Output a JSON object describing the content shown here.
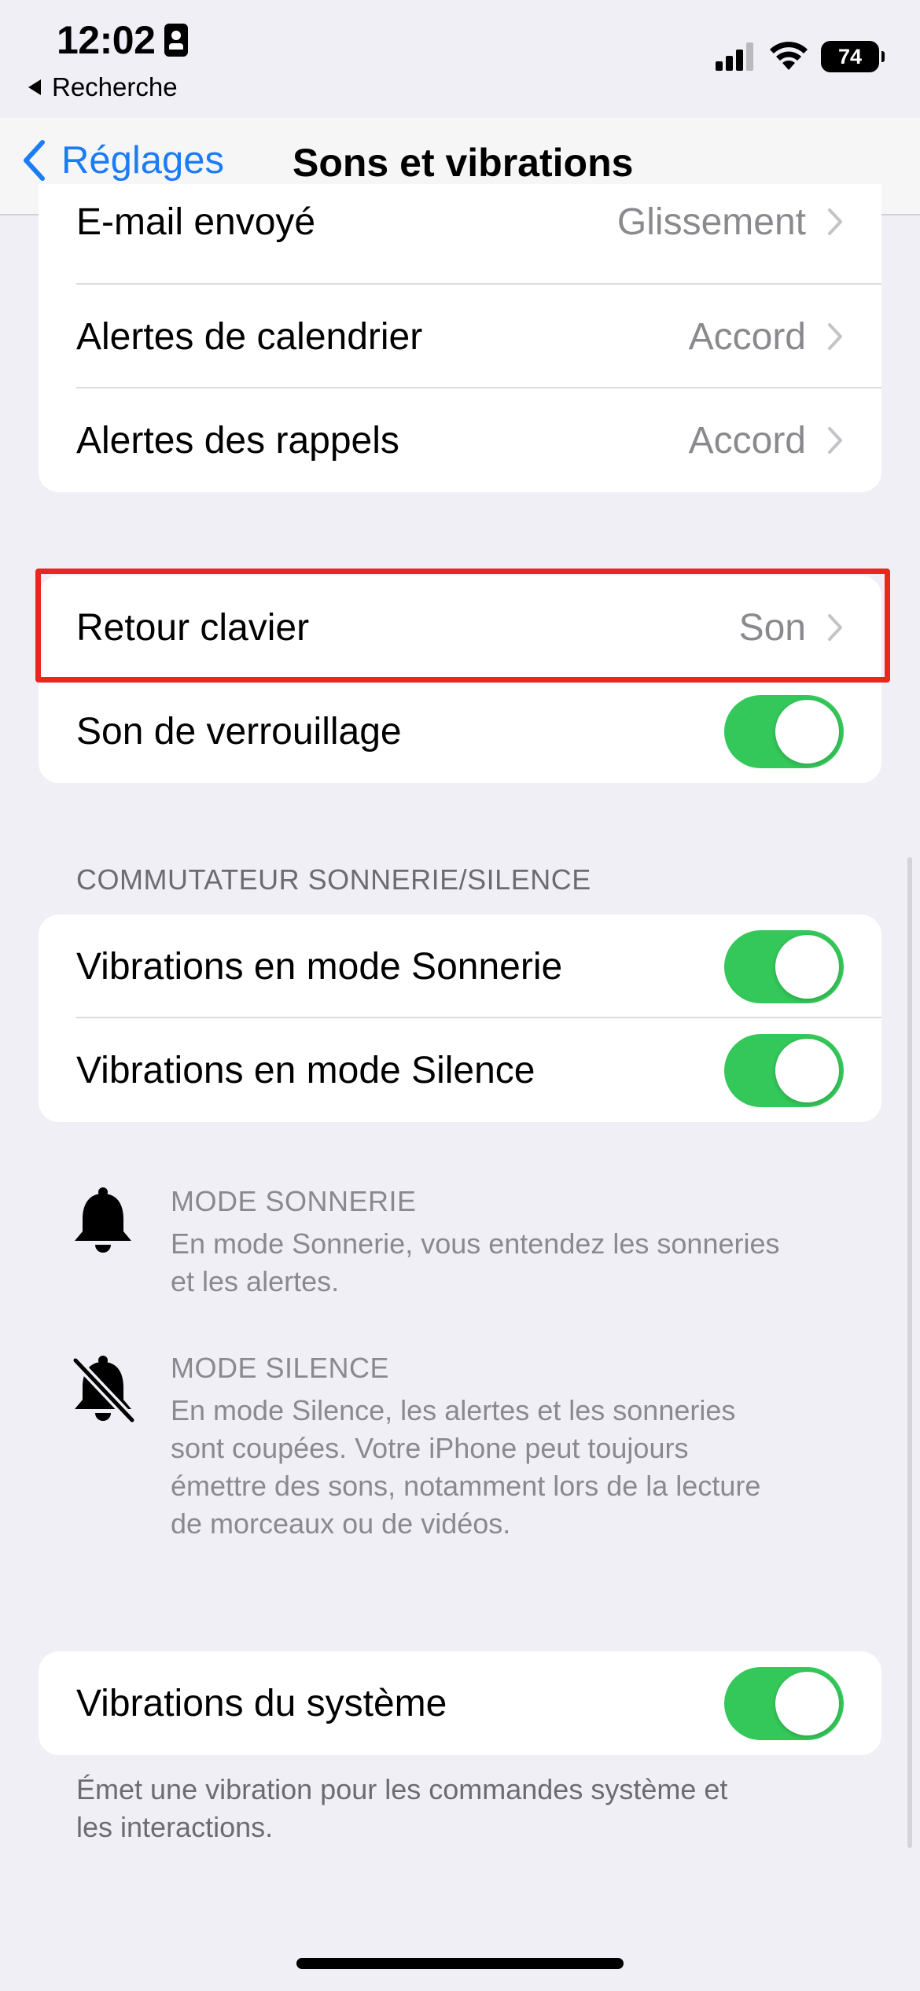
{
  "status": {
    "time": "12:02",
    "back_app": "Recherche",
    "battery": "74"
  },
  "nav": {
    "back_label": "Réglages",
    "title": "Sons et vibrations"
  },
  "sounds_group": [
    {
      "label": "E-mail envoyé",
      "value": "Glissement"
    },
    {
      "label": "Alertes de calendrier",
      "value": "Accord"
    },
    {
      "label": "Alertes des rappels",
      "value": "Accord"
    }
  ],
  "keyboard_group": {
    "keyboard_feedback": {
      "label": "Retour clavier",
      "value": "Son"
    },
    "lock_sound": {
      "label": "Son de verrouillage",
      "on": true
    }
  },
  "switch_section": {
    "header": "COMMUTATEUR SONNERIE/SILENCE",
    "ring_vibrate": {
      "label": "Vibrations en mode Sonnerie",
      "on": true
    },
    "silent_vibrate": {
      "label": "Vibrations en mode Silence",
      "on": true
    }
  },
  "info": {
    "ring": {
      "title": "MODE SONNERIE",
      "lines": [
        "En mode Sonnerie, vous entendez les sonneries",
        "et les alertes."
      ]
    },
    "silent": {
      "title": "MODE SILENCE",
      "lines": [
        "En mode Silence, les alertes et les sonneries",
        "sont coupées. Votre iPhone peut toujours",
        "émettre des sons, notamment lors de la lecture",
        "de morceaux ou de vidéos."
      ]
    }
  },
  "system_group": {
    "system_haptics": {
      "label": "Vibrations du système",
      "on": true
    },
    "footer_lines": [
      "Émet une vibration pour les commandes système et",
      "les interactions."
    ]
  },
  "colors": {
    "accent": "#1b7cf5",
    "toggle_on": "#34c759",
    "highlight": "#e8281c"
  }
}
